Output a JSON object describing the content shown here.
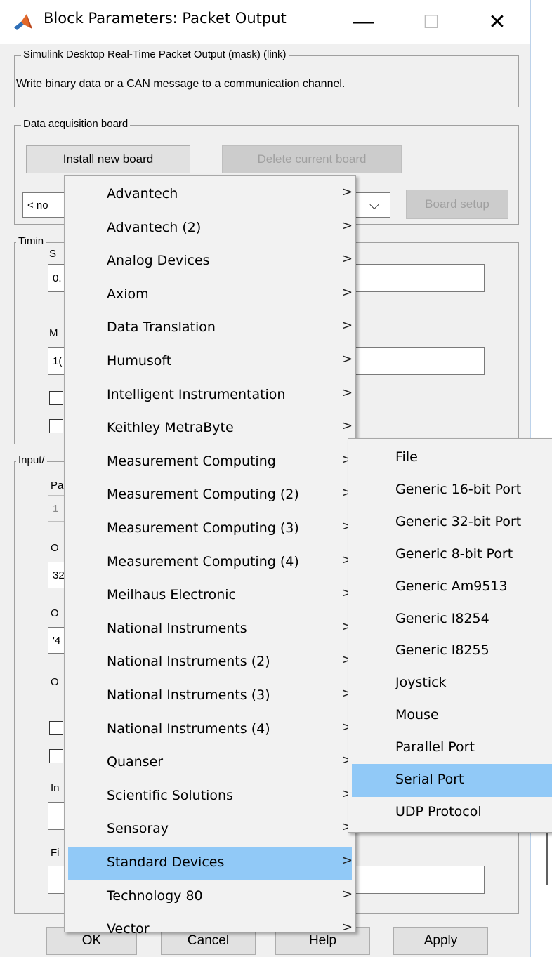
{
  "window": {
    "title": "Block Parameters: Packet Output",
    "minimize": "—",
    "maximize": "☐",
    "close": "✕"
  },
  "mask": {
    "group_label": "Simulink Desktop Real-Time Packet Output (mask) (link)",
    "description": "Write binary data or a CAN message to a communication channel."
  },
  "board": {
    "group_label": "Data acquisition board",
    "install_button": "Install new board",
    "delete_button": "Delete current board",
    "select_value": "< no",
    "select_arrow": "⌵",
    "setup_button": "Board setup"
  },
  "timing": {
    "group_label": "Timin",
    "field1_label": "S",
    "field1_value": "0.",
    "field2_label": "M",
    "field2_value": "1("
  },
  "io": {
    "group_label": "Input/",
    "label_pa": "Pa",
    "value_pa": "1",
    "label_o1": "O",
    "value_o1": "32",
    "label_o2": "O",
    "value_o2": "'4",
    "label_o3": "O",
    "label_in": "In",
    "label_fi": "Fi"
  },
  "menu": {
    "items": [
      {
        "label": "Advantech",
        "arrow": ">"
      },
      {
        "label": "Advantech (2)",
        "arrow": ">"
      },
      {
        "label": "Analog Devices",
        "arrow": ">"
      },
      {
        "label": "Axiom",
        "arrow": ">"
      },
      {
        "label": "Data Translation",
        "arrow": ">"
      },
      {
        "label": "Humusoft",
        "arrow": ">"
      },
      {
        "label": "Intelligent Instrumentation",
        "arrow": ">"
      },
      {
        "label": "Keithley MetraByte",
        "arrow": ">"
      },
      {
        "label": "Measurement Computing",
        "arrow": ">"
      },
      {
        "label": "Measurement Computing (2)",
        "arrow": ">"
      },
      {
        "label": "Measurement Computing (3)",
        "arrow": ">"
      },
      {
        "label": "Measurement Computing (4)",
        "arrow": ">"
      },
      {
        "label": "Meilhaus Electronic",
        "arrow": ">"
      },
      {
        "label": "National Instruments",
        "arrow": ">"
      },
      {
        "label": "National Instruments (2)",
        "arrow": ">"
      },
      {
        "label": "National Instruments (3)",
        "arrow": ">"
      },
      {
        "label": "National Instruments (4)",
        "arrow": ">"
      },
      {
        "label": "Quanser",
        "arrow": ">"
      },
      {
        "label": "Scientific Solutions",
        "arrow": ">"
      },
      {
        "label": "Sensoray",
        "arrow": ">"
      },
      {
        "label": "Standard Devices",
        "arrow": ">"
      },
      {
        "label": "Technology 80",
        "arrow": ">"
      },
      {
        "label": "Vector",
        "arrow": ">"
      }
    ],
    "highlighted": "Standard Devices"
  },
  "submenu": {
    "items": [
      "File",
      "Generic 16-bit Port",
      "Generic 32-bit Port",
      "Generic 8-bit Port",
      "Generic Am9513",
      "Generic I8254",
      "Generic I8255",
      "Joystick",
      "Mouse",
      "Parallel Port",
      "Serial Port",
      "UDP Protocol"
    ],
    "highlighted": "Serial Port"
  },
  "footer": {
    "ok": "OK",
    "cancel": "Cancel",
    "help": "Help",
    "apply": "Apply"
  },
  "colors": {
    "highlight": "#91c9f7",
    "window_bg": "#f0f0f0"
  }
}
